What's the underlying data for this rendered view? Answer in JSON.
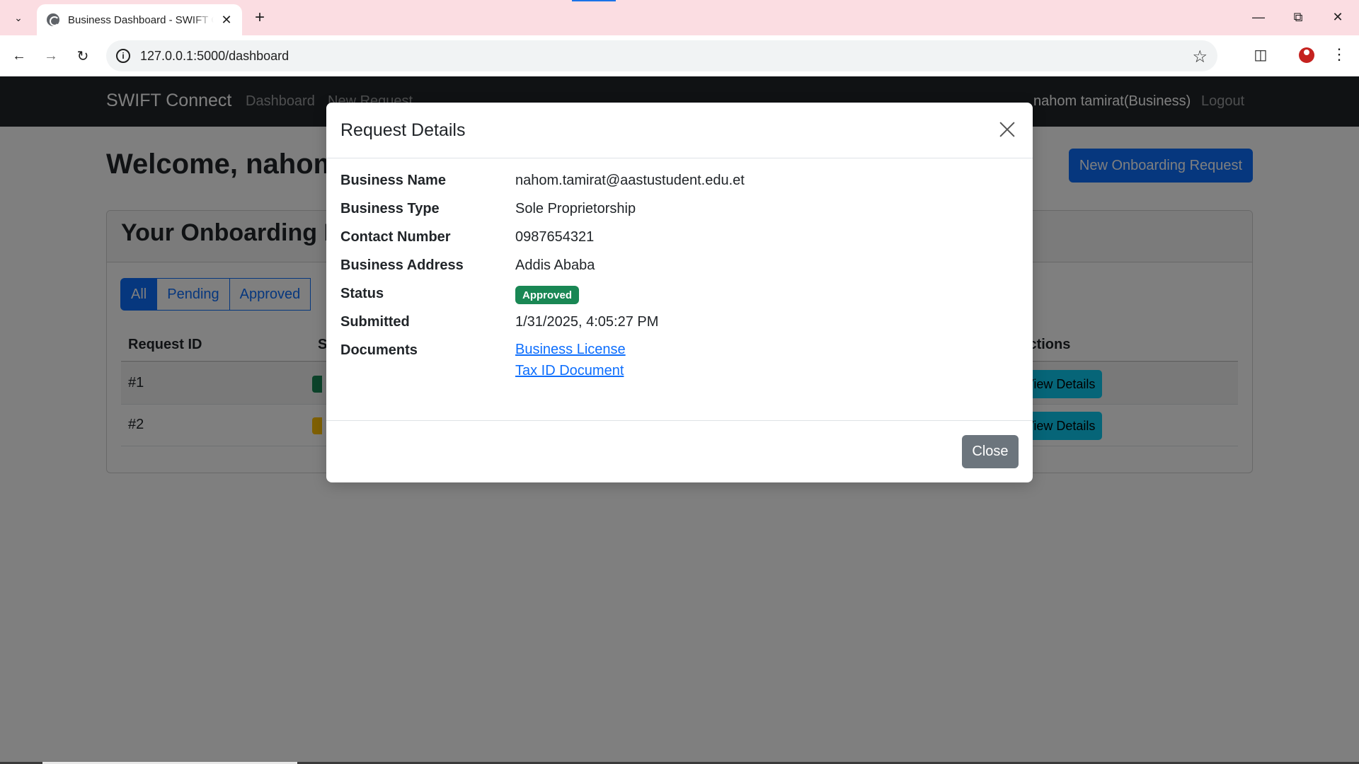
{
  "browser": {
    "tab_title": "Business Dashboard - SWIFT Connect",
    "url": "127.0.0.1:5000/dashboard"
  },
  "navbar": {
    "brand": "SWIFT Connect",
    "links": [
      "Dashboard",
      "New Request"
    ],
    "user": "nahom tamirat(Business)",
    "logout": "Logout"
  },
  "main": {
    "welcome": "Welcome, nahom",
    "new_request_button": "New Onboarding Request",
    "card_title": "Your Onboarding Requests",
    "filters": [
      "All",
      "Pending",
      "Approved"
    ],
    "columns": {
      "id": "Request ID",
      "status": "S",
      "actions": "Actions"
    },
    "rows": [
      {
        "id": "#1",
        "status_color": "#198754",
        "action": "View Details"
      },
      {
        "id": "#2",
        "status_color": "#ffc107",
        "action": "View Details"
      }
    ]
  },
  "modal": {
    "title": "Request Details",
    "fields": [
      {
        "label": "Business Name",
        "value": "nahom.tamirat@aastustudent.edu.et"
      },
      {
        "label": "Business Type",
        "value": "Sole Proprietorship"
      },
      {
        "label": "Contact Number",
        "value": "0987654321"
      },
      {
        "label": "Business Address",
        "value": "Addis Ababa"
      },
      {
        "label": "Status",
        "value": "Approved"
      },
      {
        "label": "Submitted",
        "value": "1/31/2025, 4:05:27 PM"
      },
      {
        "label": "Documents",
        "links": [
          "Business License",
          "Tax ID Document"
        ]
      }
    ],
    "close_button": "Close"
  },
  "colors": {
    "primary": "#0d6efd",
    "info": "#0dcaf0",
    "success": "#198754",
    "warning": "#ffc107",
    "secondary": "#6c757d",
    "navbar": "#212529",
    "tabbar": "#fbdde2"
  },
  "icons": [
    "tab-list-icon",
    "globe-icon",
    "close-icon",
    "plus-icon",
    "minimize-icon",
    "restore-icon",
    "back-icon",
    "forward-icon",
    "reload-icon",
    "site-info-icon",
    "star-icon",
    "extensions-icon",
    "profile-icon",
    "kebab-menu-icon"
  ]
}
